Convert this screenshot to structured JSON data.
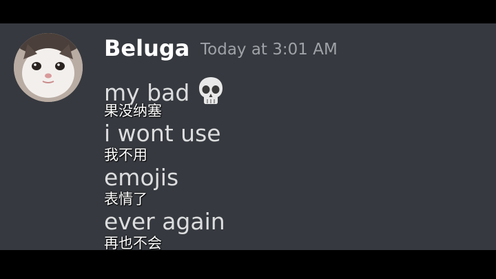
{
  "message": {
    "author": "Beluga",
    "timestamp": "Today at 3:01 AM",
    "lines": [
      {
        "text": "my bad",
        "subtitle": "果没纳塞"
      },
      {
        "text": "i wont use",
        "subtitle": "我不用"
      },
      {
        "text": "emojis",
        "subtitle": "表情了"
      },
      {
        "text": "ever again",
        "subtitle": "再也不会"
      }
    ],
    "emoji": "skull-icon"
  },
  "colors": {
    "background": "#36393f",
    "letterbox": "#000000",
    "author": "#ffffff",
    "timestamp": "#9fa3a8",
    "message_text": "#dcddde",
    "subtitle_text": "#ffffff"
  }
}
